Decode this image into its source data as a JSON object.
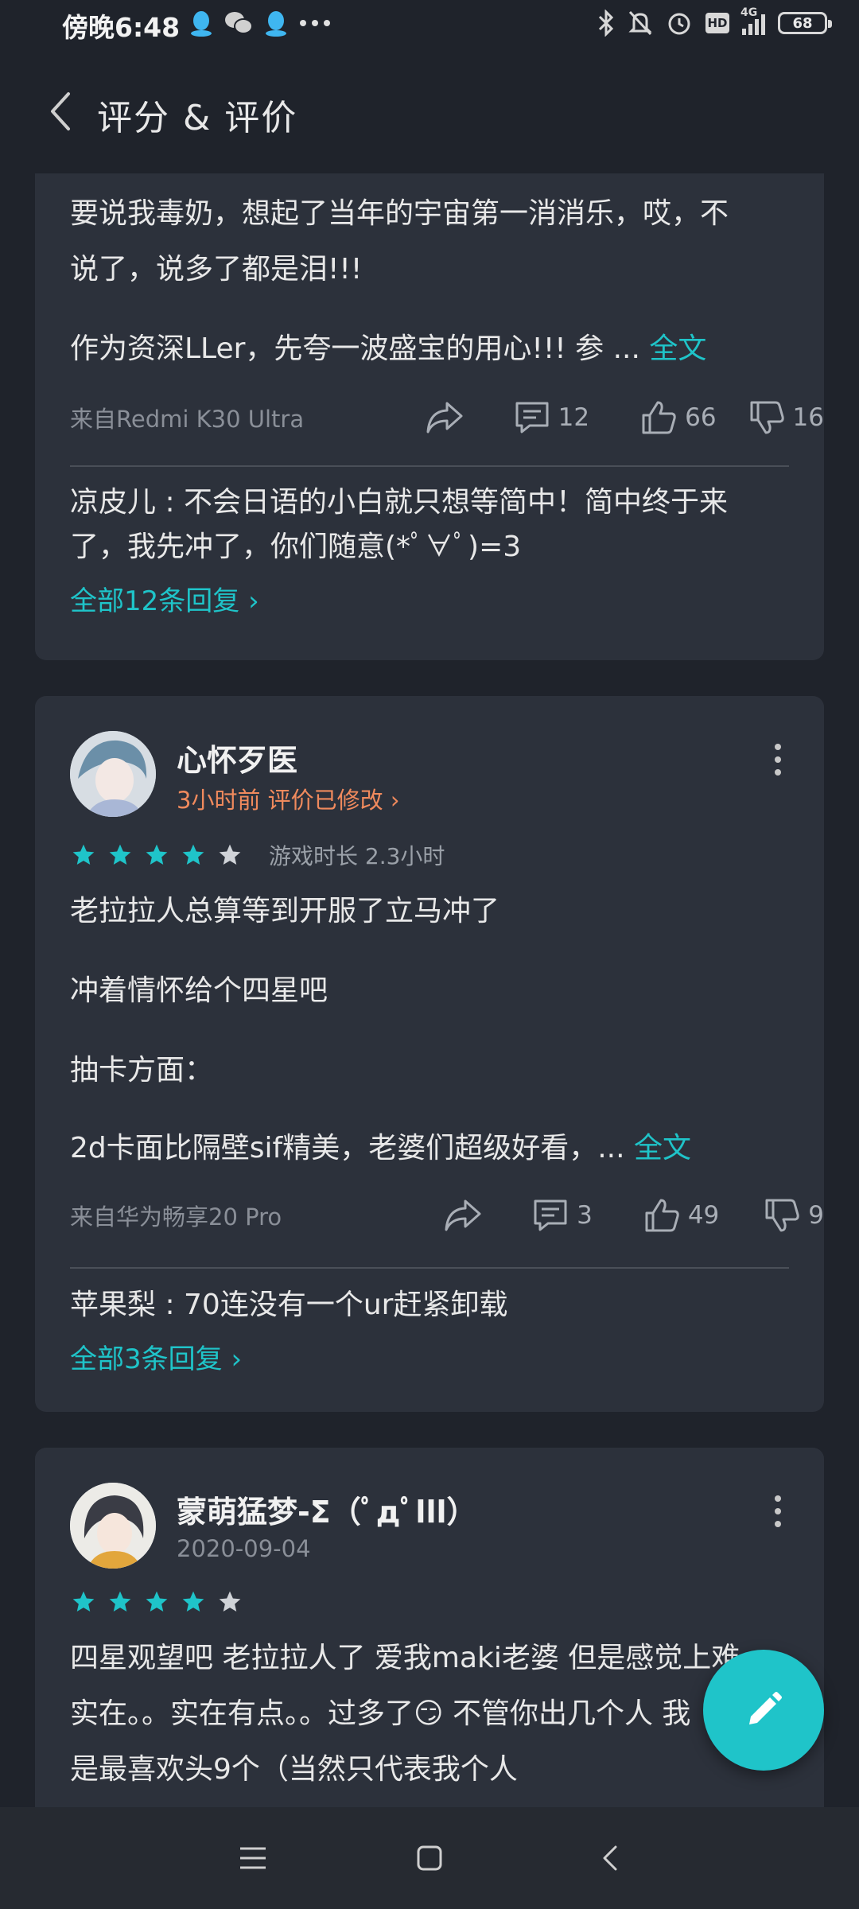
{
  "status_bar": {
    "time": "傍晚6:48",
    "battery": "68",
    "network": "4G",
    "hd": "HD",
    "icons": [
      "qq-icon",
      "wechat-icon",
      "qq-icon",
      "more-dots-icon",
      "bluetooth-icon",
      "mute-bell-icon",
      "alarm-icon",
      "hd-icon",
      "signal-icon",
      "battery-icon"
    ]
  },
  "header": {
    "title": "评分 & 评价"
  },
  "review1": {
    "line1": "要说我毒奶，想起了当年的宇宙第一消消乐，哎，不",
    "line2": "说了，说多了都是泪!!!",
    "line3": "作为资深LLer，先夸一波盛宝的用心!!! 参 ...",
    "full_text": "全文",
    "device": "来自Redmi K30 Ultra",
    "comments": "12",
    "likes": "66",
    "dislikes": "16",
    "reply_line1": "凉皮儿 : 不会日语的小白就只想等简中！简中终于来",
    "reply_line2": "了，我先冲了，你们随意(*ﾟ∀ﾟ)=3",
    "all_replies": "全部12条回复 ›"
  },
  "review2": {
    "username": "心怀歹医",
    "time": "3小时前",
    "modified": "评价已修改 ›",
    "rating": 4,
    "play_time": "游戏时长 2.3小时",
    "p1": "老拉拉人总算等到开服了立马冲了",
    "p2": "冲着情怀给个四星吧",
    "p3": "抽卡方面：",
    "p4": "2d卡面比隔壁sif精美，老婆们超级好看，...",
    "full_text": "全文",
    "device": "来自华为畅享20 Pro",
    "comments": "3",
    "likes": "49",
    "dislikes": "9",
    "reply": "苹果梨 : 70连没有一个ur赶紧卸载",
    "all_replies": "全部3条回复 ›"
  },
  "review3": {
    "username": "蒙萌猛梦-Σ（ﾟдﾟlll）",
    "date": "2020-09-04",
    "rating": 4,
    "line1": "四星观望吧 老拉拉人了 爱我maki老婆 但是感觉上难",
    "line2": "实在。。实在有点。。过多了😏 不管你出几个人 我",
    "line3": "是最喜欢头9个（当然只代表我个人"
  },
  "colors": {
    "accent": "#1fc4c9",
    "orange": "#f08a5d",
    "card": "#2c313b",
    "background": "#1f232b"
  }
}
